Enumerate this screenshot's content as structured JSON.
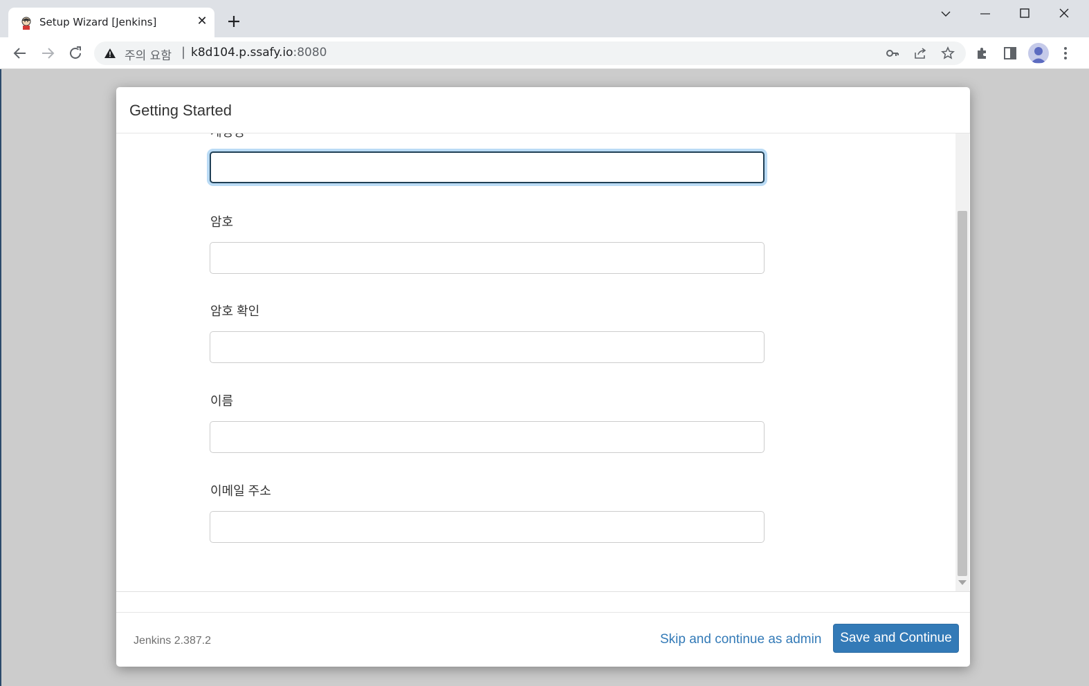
{
  "browser": {
    "tab": {
      "title": "Setup Wizard [Jenkins]",
      "favicon": "jenkins-butler-icon",
      "close_glyph": "✕"
    },
    "omnibox": {
      "security_label": "주의 요함",
      "separator": "|",
      "url_host": "k8d104.p.ssafy.io",
      "url_port": ":8080"
    },
    "icons": [
      "back-arrow-icon",
      "forward-arrow-icon",
      "reload-icon",
      "warning-icon",
      "key-icon",
      "share-icon",
      "star-icon",
      "extensions-icon",
      "side-panel-icon",
      "profile-avatar-icon",
      "kebab-menu-icon"
    ]
  },
  "modal": {
    "title": "Getting Started",
    "fields": [
      {
        "label": "계정명",
        "value": ""
      },
      {
        "label": "암호",
        "value": ""
      },
      {
        "label": "암호 확인",
        "value": ""
      },
      {
        "label": "이름",
        "value": ""
      },
      {
        "label": "이메일 주소",
        "value": ""
      }
    ],
    "footer": {
      "version": "Jenkins 2.387.2",
      "skip_label": "Skip and continue as admin",
      "save_label": "Save and Continue"
    }
  },
  "colors": {
    "accent": "#337ab7",
    "focus_ring": "#66afe9",
    "page_background": "#cccccc"
  }
}
